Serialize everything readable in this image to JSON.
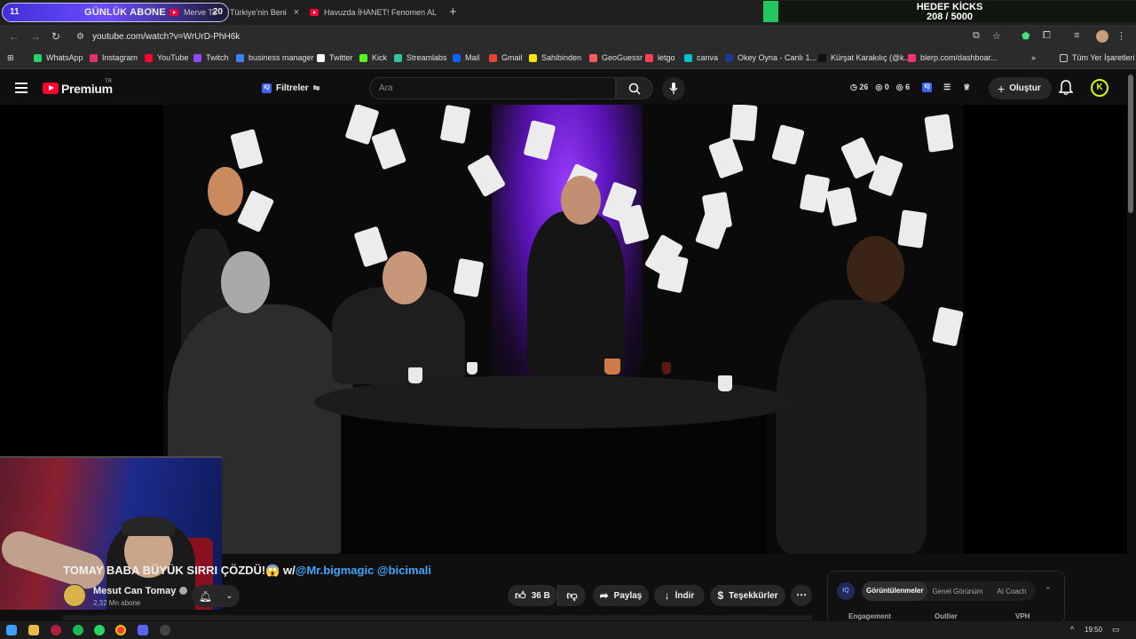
{
  "browser": {
    "subscriber_goal": {
      "left_count": "11",
      "label": "GÜNLÜK ABONE",
      "right_count": "20"
    },
    "tabs": [
      {
        "label": "Merve Ta",
        "close": "×"
      },
      {
        "label": "Türkiye'nin Beni",
        "close": "×"
      },
      {
        "label": "Havuzda İHANET! Fenomen AL",
        "close": "×"
      }
    ],
    "new_tab": "+",
    "close_a": "×",
    "kicks_goal": {
      "title": "HEDEF KİCKS",
      "count": "208 / 5000",
      "progress": 0.0416,
      "color": "#22c55e"
    },
    "url": "youtube.com/watch?v=WrUrD-PhH6k",
    "bookmarks": [
      {
        "label": "WhatsApp",
        "color": "#25d366"
      },
      {
        "label": "Instagram",
        "color": "#e1306c"
      },
      {
        "label": "YouTube",
        "color": "#ff0033"
      },
      {
        "label": "Twitch",
        "color": "#9146ff"
      },
      {
        "label": "business manager",
        "color": "#3b82f6"
      },
      {
        "label": "Twitter",
        "color": "#ffffff"
      },
      {
        "label": "Kick",
        "color": "#53fc18"
      },
      {
        "label": "Streamlabs",
        "color": "#31c3a2"
      },
      {
        "label": "Mail",
        "color": "#0a64ff"
      },
      {
        "label": "Gmail",
        "color": "#ea4335"
      },
      {
        "label": "Sahibinden",
        "color": "#ffe800"
      },
      {
        "label": "GeoGuessr",
        "color": "#ff5a5a"
      },
      {
        "label": "letgo",
        "color": "#ff3f55"
      },
      {
        "label": "canva",
        "color": "#00c4cc"
      },
      {
        "label": "Okey Oyna - Canlı 1...",
        "color": "#1f3a93"
      },
      {
        "label": "Kürşat Karakılıç (@k...",
        "color": "#111111"
      },
      {
        "label": "blerp.com/dashboar...",
        "color": "#ff2d77"
      }
    ],
    "bookmarks_more": "»",
    "all_bookmarks": "Tüm Yer İşaretleri"
  },
  "youtube": {
    "brand": "Premium",
    "region": "TR",
    "filters_label": "Filtreler",
    "search_placeholder": "Ara",
    "stats": {
      "a": "26",
      "b": "0",
      "c": "6"
    },
    "create_label": "Oluştur",
    "avatar_letter": "K",
    "video_title": "TOMAY BABA BÜYÜK SIRRI ÇÖZDÜ!😱 w/",
    "video_title_mentions": "@Mr.bigmagic @bicimali",
    "channel": {
      "name": "Mesut Can Tomay",
      "subscribers": "2,32 Mn abone"
    },
    "actions": {
      "likes": "36 B",
      "share": "Paylaş",
      "download": "İndir",
      "thanks": "Teşekkürler"
    },
    "vidiq": {
      "logo": "IQ",
      "tabs": [
        "Görüntülenmeler",
        "Genel Görünüm",
        "AI Coach"
      ],
      "columns": [
        "Engagement",
        "Outlier",
        "VPH"
      ]
    }
  },
  "taskbar": {
    "clock": "19:50"
  }
}
